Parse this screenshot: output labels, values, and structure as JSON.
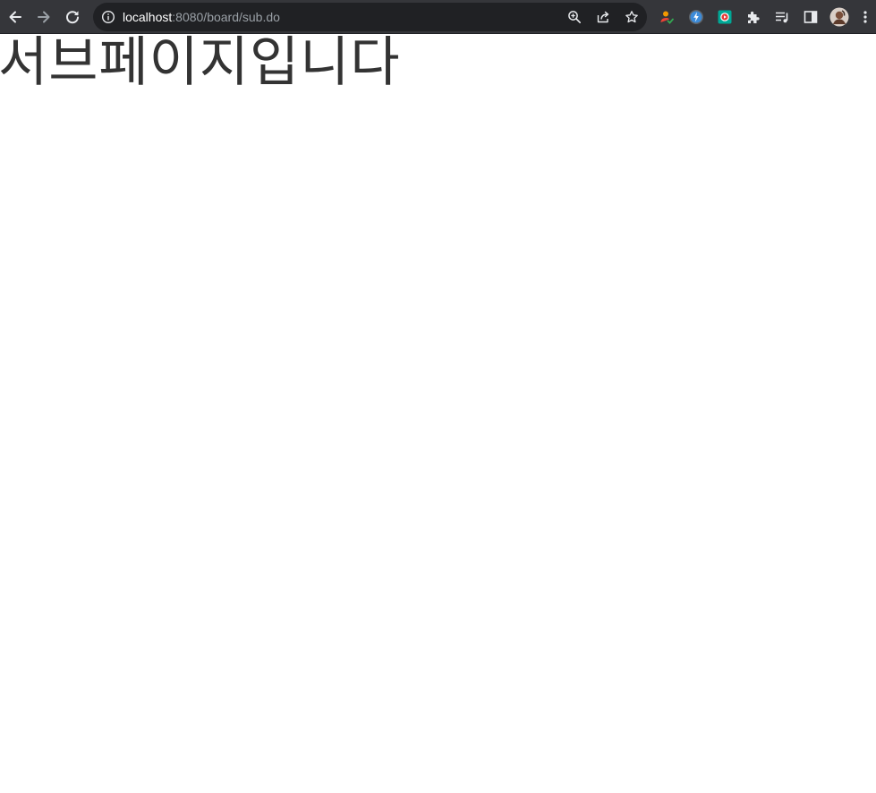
{
  "browser": {
    "url_host": "localhost",
    "url_path": ":8080/board/sub.do",
    "icons": {
      "back": "arrow-left-icon",
      "forward": "arrow-right-icon",
      "reload": "reload-icon",
      "site_info": "info-icon",
      "zoom": "zoom-icon",
      "share": "share-icon",
      "bookmark": "star-icon",
      "extensions": "puzzle-icon",
      "media": "media-queue-icon",
      "side_panel": "side-panel-icon",
      "menu": "kebab-menu-icon"
    },
    "colors": {
      "toolbar_bg": "#35363a",
      "omnibox_bg": "#202124",
      "url_host": "#ffffff",
      "url_path": "#9aa0a6"
    }
  },
  "page": {
    "heading": "서브페이지입니다"
  }
}
